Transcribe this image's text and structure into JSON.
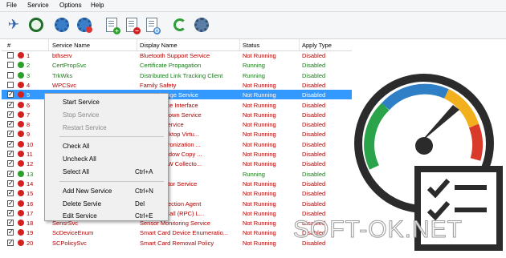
{
  "menu": [
    "File",
    "Service",
    "Options",
    "Help"
  ],
  "toolbar": {
    "icons": [
      "plane-icon",
      "speedometer-icon",
      "service-gear-icon",
      "service-gear-stop-icon",
      "list-add-icon",
      "list-remove-icon",
      "list-settings-icon",
      "refresh-icon",
      "settings-gear-icon"
    ]
  },
  "table": {
    "columns": [
      "#",
      "Service Name",
      "Display Name",
      "Status",
      "Apply Type"
    ],
    "rows": [
      {
        "checked": false,
        "status_color": "red",
        "num": "1",
        "name": "bthserv",
        "display": "Bluetooth Support Service",
        "status": "Not Running",
        "apply": "Disabled"
      },
      {
        "checked": false,
        "status_color": "green",
        "num": "2",
        "name": "CertPropSvc",
        "display": "Certificate Propagation",
        "status": "Running",
        "apply": "Disabled"
      },
      {
        "checked": false,
        "status_color": "green",
        "num": "3",
        "name": "TrkWks",
        "display": "Distributed Link Tracking Client",
        "status": "Running",
        "apply": "Disabled"
      },
      {
        "checked": false,
        "status_color": "red",
        "num": "4",
        "name": "WPCSvc",
        "display": "Family Safety",
        "status": "Not Running",
        "apply": "Disabled"
      },
      {
        "checked": true,
        "status_color": "red",
        "num": "5",
        "name": "",
        "display": "ata Exchange Service",
        "status": "Not Running",
        "apply": "Disabled"
      },
      {
        "checked": true,
        "status_color": "red",
        "num": "6",
        "name": "",
        "display": "uest Service Interface",
        "status": "Not Running",
        "apply": "Disabled"
      },
      {
        "checked": true,
        "status_color": "red",
        "num": "7",
        "name": "",
        "display": "uest Shutdown Service",
        "status": "Not Running",
        "apply": "Disabled"
      },
      {
        "checked": true,
        "status_color": "red",
        "num": "8",
        "name": "",
        "display": "eartbeat Service",
        "status": "Not Running",
        "apply": "Disabled"
      },
      {
        "checked": true,
        "status_color": "red",
        "num": "9",
        "name": "",
        "display": "emote Desktop Virtu...",
        "status": "Not Running",
        "apply": "Disabled"
      },
      {
        "checked": true,
        "status_color": "red",
        "num": "10",
        "name": "",
        "display": "ime Synchronization ...",
        "status": "Not Running",
        "apply": "Disabled"
      },
      {
        "checked": true,
        "status_color": "red",
        "num": "11",
        "name": "",
        "display": "olume Shadow Copy ...",
        "status": "Not Running",
        "apply": "Disabled"
      },
      {
        "checked": true,
        "status_color": "red",
        "num": "12",
        "name": "",
        "display": "xplorer ETW Collecto...",
        "status": "Not Running",
        "apply": "Disabled"
      },
      {
        "checked": true,
        "status_color": "green",
        "num": "13",
        "name": "",
        "display": "",
        "status": "Running",
        "apply": "Disabled"
      },
      {
        "checked": true,
        "status_color": "red",
        "num": "14",
        "name": "",
        "display": "SCSI Initiator Service",
        "status": "Not Running",
        "apply": "Disabled"
      },
      {
        "checked": true,
        "status_color": "red",
        "num": "15",
        "name": "",
        "display": "",
        "status": "Not Running",
        "apply": "Disabled"
      },
      {
        "checked": true,
        "status_color": "red",
        "num": "16",
        "name": "",
        "display": "ccess Protection Agent",
        "status": "Not Running",
        "apply": "Disabled"
      },
      {
        "checked": true,
        "status_color": "red",
        "num": "17",
        "name": "",
        "display": "rocedure Call (RPC) L...",
        "status": "Not Running",
        "apply": "Disabled"
      },
      {
        "checked": true,
        "status_color": "red",
        "num": "18",
        "name": "SensrSvc",
        "display": "Sensor Monitoring Service",
        "status": "Not Running",
        "apply": "Disabled"
      },
      {
        "checked": true,
        "status_color": "red",
        "num": "19",
        "name": "ScDeviceEnum",
        "display": "Smart Card Device Enumeratio...",
        "status": "Not Running",
        "apply": "Disabled"
      },
      {
        "checked": true,
        "status_color": "red",
        "num": "20",
        "name": "SCPolicySvc",
        "display": "Smart Card Removal Policy",
        "status": "Not Running",
        "apply": "Disabled"
      }
    ]
  },
  "context_menu": [
    {
      "label": "Start Service",
      "shortcut": "",
      "enabled": true
    },
    {
      "label": "Stop Service",
      "shortcut": "",
      "enabled": false
    },
    {
      "label": "Restart Service",
      "shortcut": "",
      "enabled": false
    },
    {
      "separator": true
    },
    {
      "label": "Check All",
      "shortcut": "",
      "enabled": true
    },
    {
      "label": "Uncheck All",
      "shortcut": "",
      "enabled": true
    },
    {
      "label": "Select All",
      "shortcut": "Ctrl+A",
      "enabled": true
    },
    {
      "separator": true
    },
    {
      "label": "Add New Service",
      "shortcut": "Ctrl+N",
      "enabled": true
    },
    {
      "label": "Delete Servie",
      "shortcut": "Del",
      "enabled": true
    },
    {
      "label": "Edit Service",
      "shortcut": "Ctrl+E",
      "enabled": true
    }
  ],
  "watermark": "SOFT-OK.NET",
  "colors": {
    "running_text": "#1a7a1a",
    "stopped_text": "#b00000",
    "selection": "#3399ff",
    "status_red": "#d32020",
    "status_green": "#2aa02a"
  }
}
